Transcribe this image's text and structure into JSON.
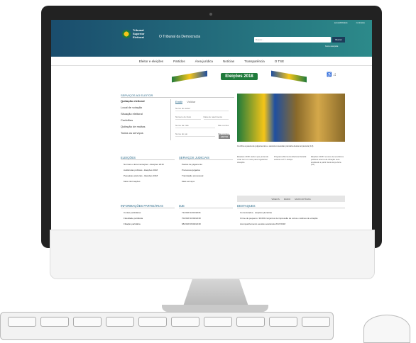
{
  "header": {
    "logo_lines": [
      "Tribunal",
      "Superior",
      "Eleitoral"
    ],
    "tagline": "O Tribunal da Democracia",
    "util_links": [
      "acessibilidade",
      "contraste"
    ],
    "search_placeholder": "Buscar...",
    "search_button": "Buscar",
    "search_advanced": "busca avançada"
  },
  "nav": {
    "items": [
      "Eleitor e eleições",
      "Partidos",
      "Área jurídica",
      "Notícias",
      "Transparência",
      "O TSE"
    ]
  },
  "banner": {
    "title": "Eleições",
    "year": "2018"
  },
  "services": {
    "title": "SERVIÇOS AO ELEITOR",
    "items": [
      "Quitação eleitoral",
      "Local de votação",
      "Situação eleitoral",
      "Certidões",
      "Quitação de multas",
      "Todos os serviços"
    ],
    "form": {
      "tabs": [
        "Emitir",
        "Validar"
      ],
      "fields": [
        "Nome do eleitor",
        "Número do título",
        "Data de nascimento",
        "Nome da mãe",
        "Nome do pai"
      ],
      "options": [
        "Não consta",
        "Não consta"
      ],
      "button": "EMITIR"
    }
  },
  "feature": {
    "caption": "Confira a pauta de julgamentos e assista à sessão plenária desta terça-feira (13)",
    "news": [
      "Eleições 2018: eleitor que pretende votar tem um mês para regularizar situação",
      "Programa Momento Eleitoral da EJE estreia na TV Justiça",
      "Eleições 2018: recurso de servidores públicos acerca da infração será analisado a partir desta terça-feira (10)"
    ],
    "pager": [
      "VÍDEOS",
      "RÁDIO",
      "MAIS NOTÍCIAS"
    ]
  },
  "sections": {
    "eleicoes": {
      "title": "ELEIÇÕES",
      "items": [
        "Normas e documentações - Eleições 2018",
        "Audiências públicas - Eleições 2018",
        "Pesquisas eleitorais - Eleições 2018",
        "Mais informações"
      ]
    },
    "judiciais": {
      "title": "SERVIÇOS JUDICIAIS",
      "items": [
        "Pautas de julgamento",
        "Processos julgados",
        "Tramitação processual",
        "Mais serviços"
      ]
    },
    "partidarias": {
      "title": "INFORMAÇÕES PARTIDÁRIAS",
      "items": [
        "Contas partidárias",
        "Fidelidade partidária",
        "Filiação partidária"
      ]
    },
    "dje": {
      "title": "DJE",
      "items": [
        "71/2018 11/04/2018",
        "70/2018 10/04/2018",
        "68/2018 09/04/2018"
      ]
    },
    "destaques": {
      "title": "DESTAQUES",
      "items": [
        "Comunicados - eleições plenárias",
        "Crime de pequeno: 30.000 conjuntos de impressão de votos e cabines de votação",
        "Acompanhamento sessões eleitorais 2017/2018"
      ]
    }
  }
}
